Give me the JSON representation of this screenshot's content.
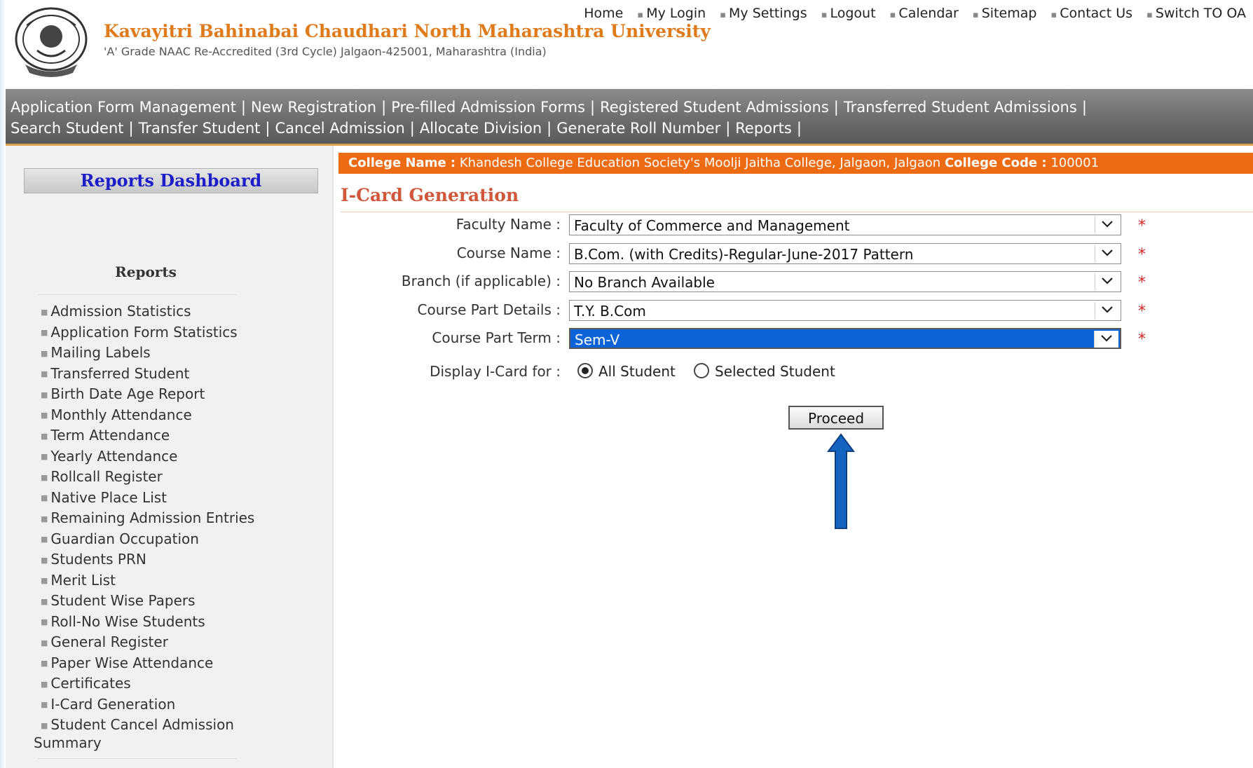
{
  "header": {
    "university_name": "Kavayitri Bahinabai Chaudhari North Maharashtra University",
    "subtitle": "'A' Grade NAAC Re-Accredited (3rd Cycle) Jalgaon-425001, Maharashtra (India)",
    "top_links": [
      "Home",
      "My Login",
      "My Settings",
      "Logout",
      "Calendar",
      "Sitemap",
      "Contact Us",
      "Switch TO OA"
    ]
  },
  "nav": {
    "row1": [
      "Application Form Management",
      "New Registration",
      "Pre-filled Admission Forms",
      "Registered Student Admissions",
      "Transferred Student Admissions"
    ],
    "row2": [
      "Search Student",
      "Transfer Student",
      "Cancel Admission",
      "Allocate Division",
      "Generate Roll Number",
      "Reports"
    ]
  },
  "sidebar": {
    "dashboard_title": "Reports Dashboard",
    "reports_heading": "Reports",
    "items": [
      "Admission Statistics",
      "Application Form Statistics",
      "Mailing Labels",
      "Transferred Student",
      "Birth Date Age Report",
      "Monthly Attendance",
      "Term Attendance",
      "Yearly Attendance",
      "Rollcall Register",
      "Native Place List",
      "Remaining Admission Entries",
      "Guardian Occupation",
      "Students PRN",
      "Merit List",
      "Student Wise Papers",
      "Roll-No Wise Students",
      "General Register",
      "Paper Wise Attendance",
      "Certificates",
      "I-Card Generation",
      "Student Cancel Admission Summary"
    ]
  },
  "college": {
    "name_label": "College Name :",
    "name_value": "Khandesh College Education Society's Moolji Jaitha College, Jalgaon, Jalgaon",
    "code_label": "College Code :",
    "code_value": "100001"
  },
  "page": {
    "title": "I-Card Generation",
    "fields": [
      {
        "label": "Faculty Name :",
        "value": "Faculty of Commerce and Management"
      },
      {
        "label": "Course Name :",
        "value": "B.Com. (with Credits)-Regular-June-2017 Pattern"
      },
      {
        "label": "Branch (if applicable) :",
        "value": "No Branch Available"
      },
      {
        "label": "Course Part Details :",
        "value": "T.Y. B.Com"
      },
      {
        "label": "Course Part Term :",
        "value": "Sem-V"
      }
    ],
    "required_mark": "*",
    "display_label": "Display I-Card for :",
    "radio_all": "All Student",
    "radio_selected": "Selected Student",
    "proceed_label": "Proceed"
  },
  "colors": {
    "orange": "#ec6b13",
    "title": "#d0573a",
    "dashboard_text": "#1e1ec8",
    "annotation_arrow": "#1565c0"
  }
}
